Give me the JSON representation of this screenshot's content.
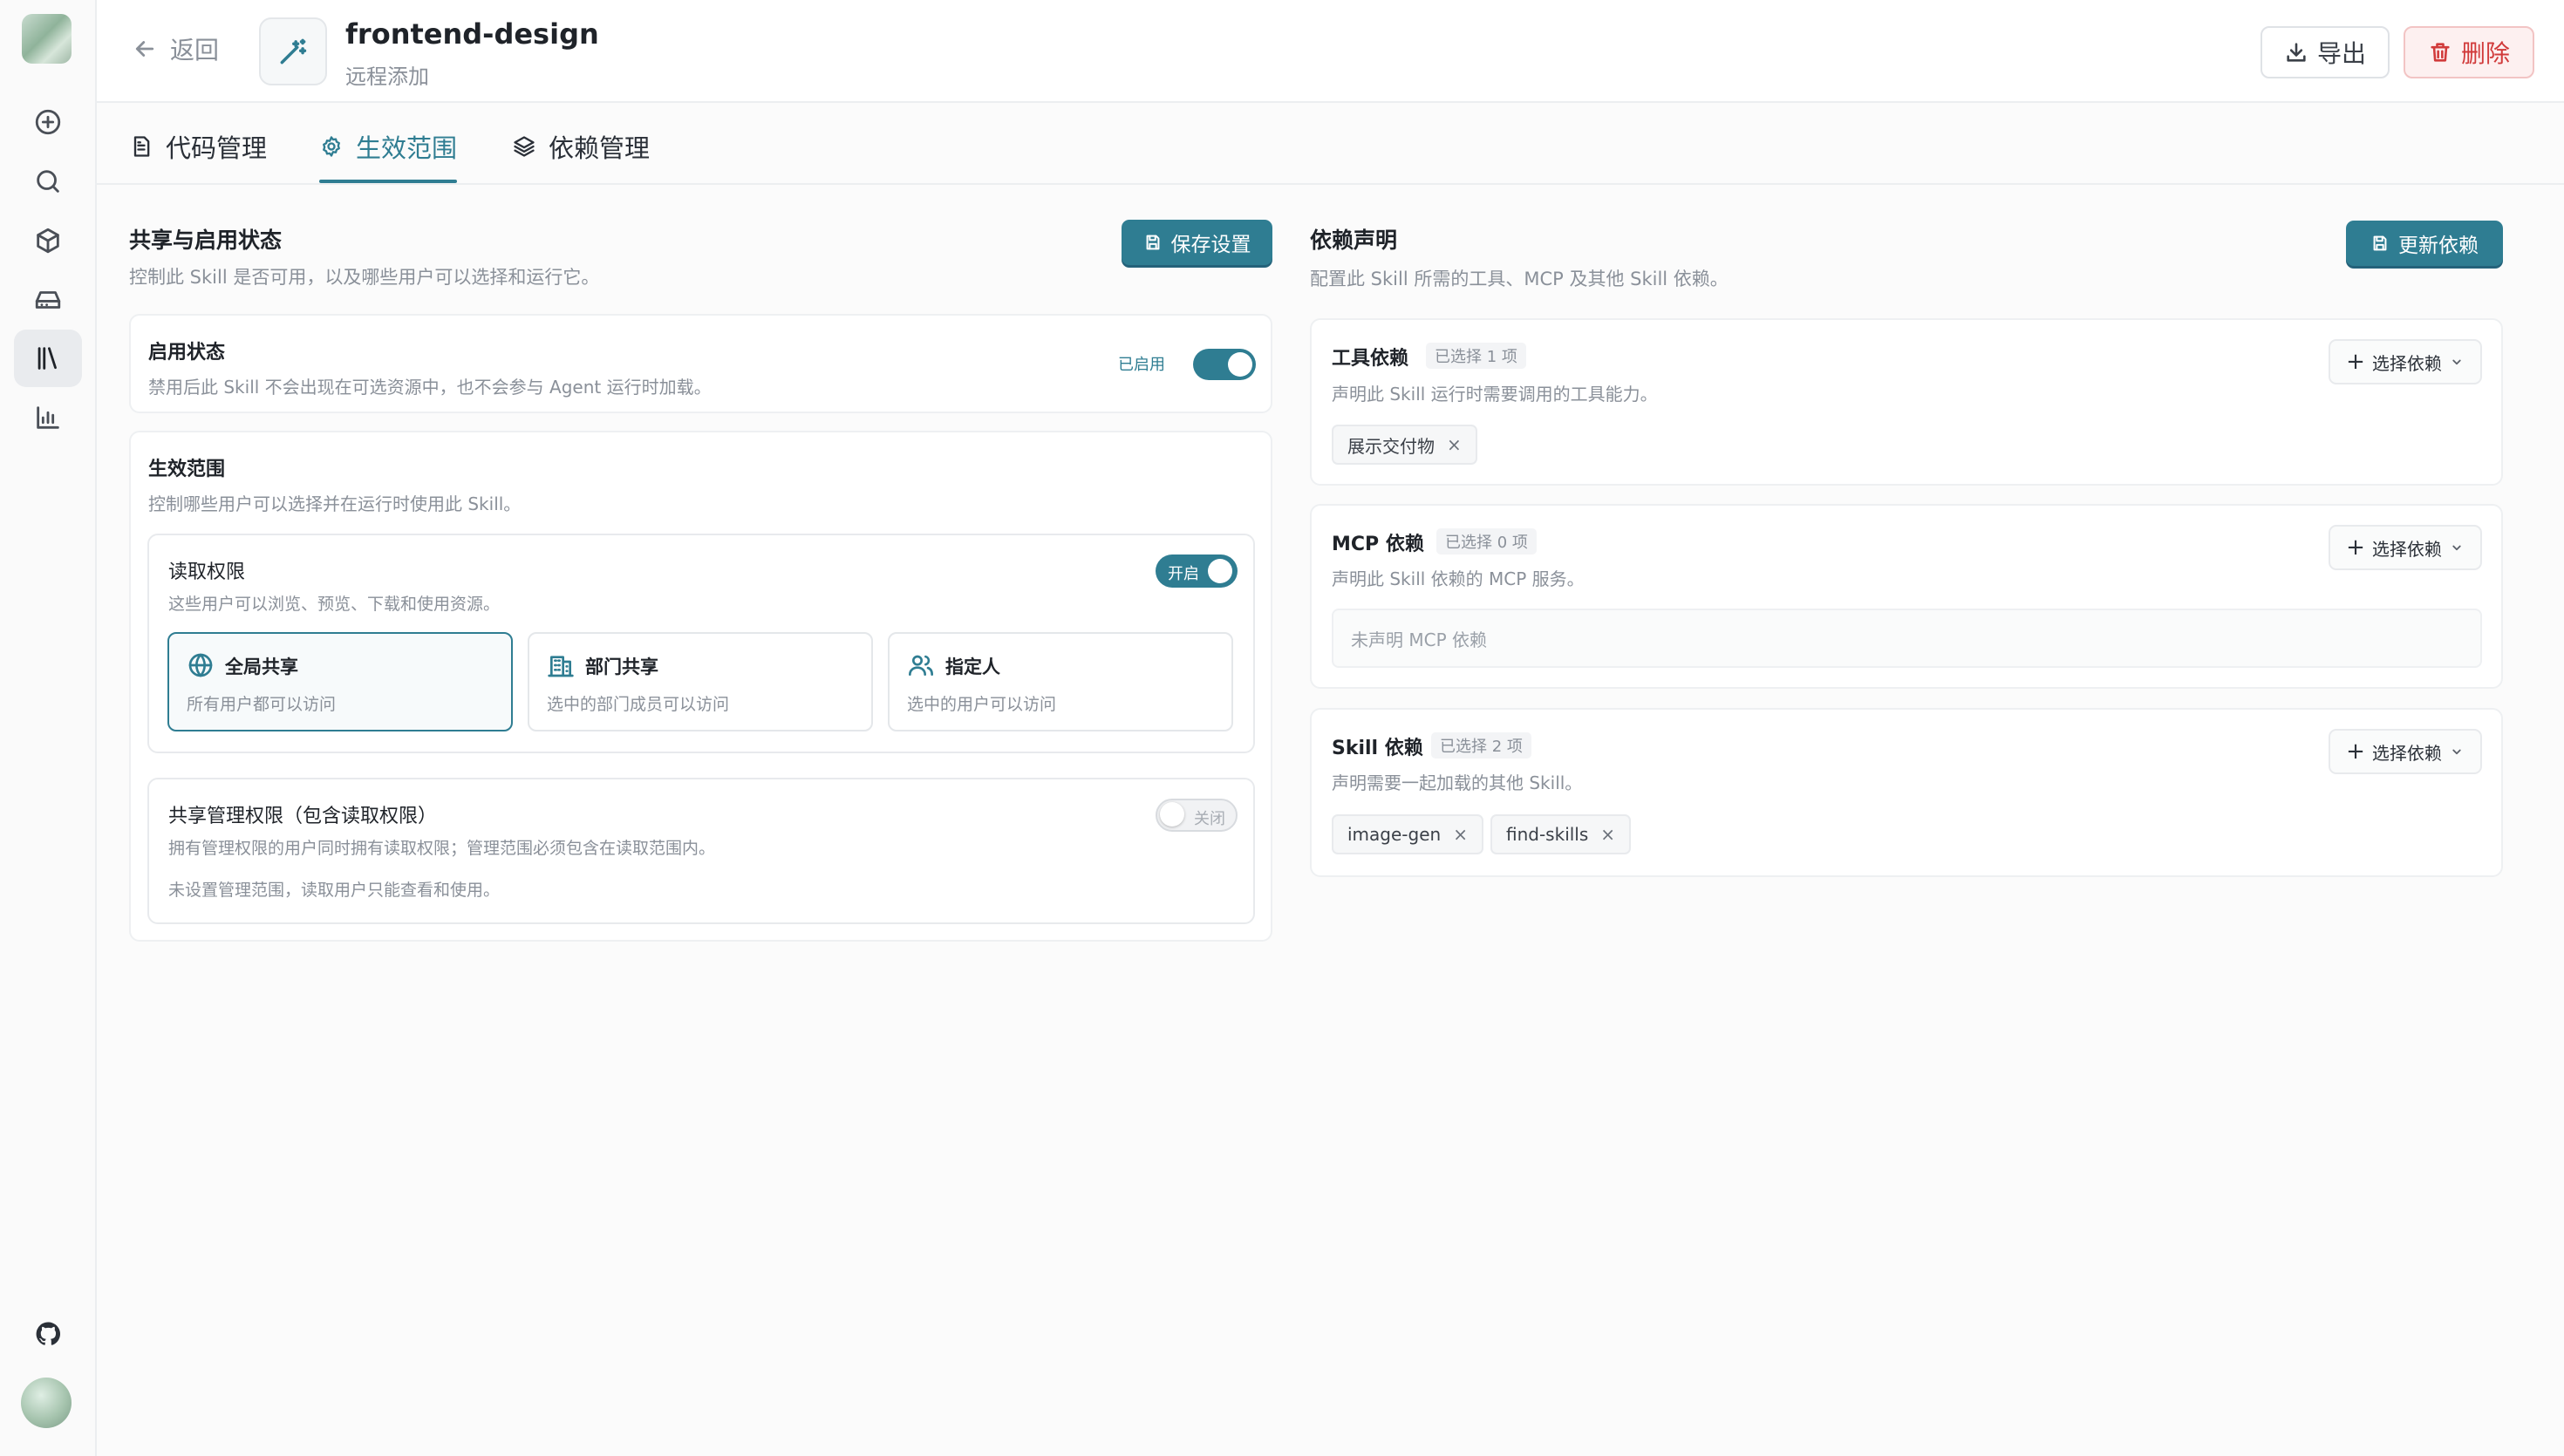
{
  "sidebar": {
    "items": [
      {
        "name": "new-chat",
        "icon": "plus-circle-icon"
      },
      {
        "name": "search",
        "icon": "search-icon"
      },
      {
        "name": "package",
        "icon": "cube-icon"
      },
      {
        "name": "storage",
        "icon": "drive-icon"
      },
      {
        "name": "library",
        "icon": "library-icon",
        "active": true
      },
      {
        "name": "analytics",
        "icon": "bar-chart-icon"
      }
    ],
    "github_icon": "github-icon"
  },
  "header": {
    "back_label": "返回",
    "title": "frontend-design",
    "subtitle": "远程添加",
    "export_label": "导出",
    "delete_label": "删除"
  },
  "tabs": [
    {
      "label": "代码管理",
      "icon": "file-text-icon"
    },
    {
      "label": "生效范围",
      "icon": "gear-icon",
      "active": true
    },
    {
      "label": "依赖管理",
      "icon": "layers-icon"
    }
  ],
  "left": {
    "title": "共享与启用状态",
    "desc": "控制此 Skill 是否可用，以及哪些用户可以选择和运行它。",
    "save_label": "保存设置",
    "enable": {
      "title": "启用状态",
      "desc": "禁用后此 Skill 不会出现在可选资源中，也不会参与 Agent 运行时加载。",
      "status": "已启用",
      "on": true
    },
    "scope": {
      "title": "生效范围",
      "desc": "控制哪些用户可以选择并在运行时使用此 Skill。",
      "read": {
        "title": "读取权限",
        "desc": "这些用户可以浏览、预览、下载和使用资源。",
        "toggle_label": "开启",
        "on": true,
        "options": [
          {
            "label": "全局共享",
            "desc": "所有用户都可以访问",
            "icon": "globe-icon",
            "selected": true
          },
          {
            "label": "部门共享",
            "desc": "选中的部门成员可以访问",
            "icon": "building-icon",
            "selected": false
          },
          {
            "label": "指定人",
            "desc": "选中的用户可以访问",
            "icon": "users-icon",
            "selected": false
          }
        ]
      },
      "manage": {
        "title": "共享管理权限（包含读取权限）",
        "desc": "拥有管理权限的用户同时拥有读取权限；管理范围必须包含在读取范围内。",
        "note": "未设置管理范围，读取用户只能查看和使用。",
        "toggle_label": "关闭",
        "on": false
      }
    }
  },
  "right": {
    "title": "依赖声明",
    "desc": "配置此 Skill 所需的工具、MCP 及其他 Skill 依赖。",
    "update_label": "更新依赖",
    "select_label": "选择依赖",
    "tools": {
      "title": "工具依赖",
      "count": "已选择 1 项",
      "desc": "声明此 Skill 运行时需要调用的工具能力。",
      "tags": [
        "展示交付物"
      ]
    },
    "mcp": {
      "title": "MCP 依赖",
      "count": "已选择 0 项",
      "desc": "声明此 Skill 依赖的 MCP 服务。",
      "empty": "未声明 MCP 依赖"
    },
    "skills": {
      "title": "Skill 依赖",
      "count": "已选择 2 项",
      "desc": "声明需要一起加载的其他 Skill。",
      "tags": [
        "image-gen",
        "find-skills"
      ]
    }
  },
  "colors": {
    "accent": "#2f7d92",
    "danger": "#d13b3b"
  }
}
